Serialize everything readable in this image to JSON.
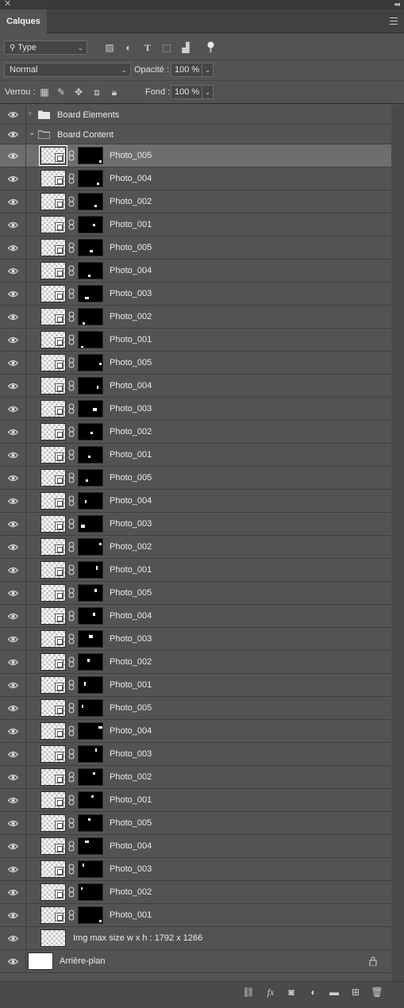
{
  "panel": {
    "title": "Calques"
  },
  "filter": {
    "type_label": "Type",
    "icons": [
      "image-filter-icon",
      "adjustment-filter-icon",
      "type-filter-icon",
      "shape-filter-icon",
      "smart-object-filter-icon"
    ]
  },
  "blend": {
    "mode": "Normal",
    "opacity_label": "Opacité :",
    "opacity_value": "100 %"
  },
  "lock": {
    "label": "Verrou :",
    "fill_label": "Fond :",
    "fill_value": "100 %"
  },
  "groups": [
    {
      "name": "Board Elements",
      "expanded": false
    },
    {
      "name": "Board Content",
      "expanded": true
    }
  ],
  "layers": [
    "Photo_005",
    "Photo_004",
    "Photo_002",
    "Photo_001",
    "Photo_005",
    "Photo_004",
    "Photo_003",
    "Photo_002",
    "Photo_001",
    "Photo_005",
    "Photo_004",
    "Photo_003",
    "Photo_002",
    "Photo_001",
    "Photo_005",
    "Photo_004",
    "Photo_003",
    "Photo_002",
    "Photo_001",
    "Photo_005",
    "Photo_004",
    "Photo_003",
    "Photo_002",
    "Photo_001",
    "Photo_005",
    "Photo_004",
    "Photo_003",
    "Photo_002",
    "Photo_001",
    "Photo_005",
    "Photo_004",
    "Photo_003",
    "Photo_002",
    "Photo_001"
  ],
  "plain_layer": {
    "name": "Img max size w x h : 1792 x 1266"
  },
  "background": {
    "name": "Arrière-plan",
    "locked": true
  },
  "selected_layer_index": 0,
  "footer_icons": [
    "link-layers-icon",
    "fx-icon",
    "add-mask-icon",
    "new-adjustment-icon",
    "new-group-icon",
    "new-layer-icon",
    "delete-icon"
  ]
}
